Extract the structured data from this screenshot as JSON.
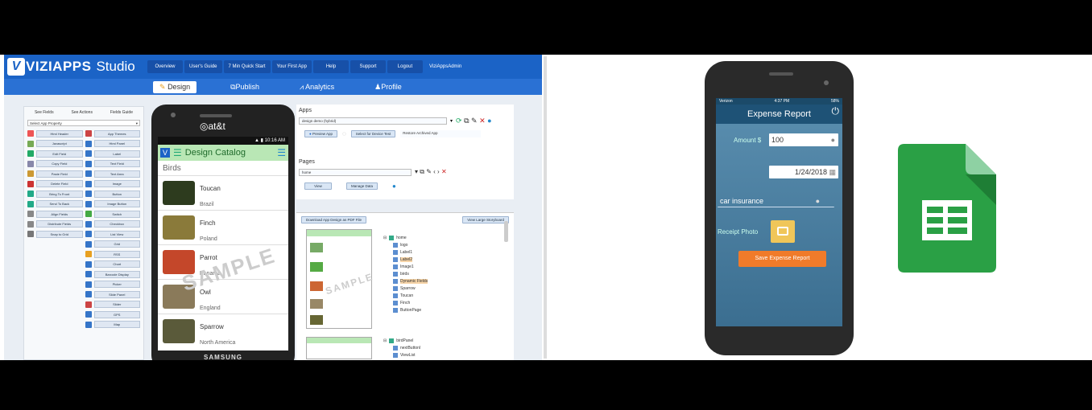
{
  "studio": {
    "logo_brand": "VIZIAPPS",
    "logo_studio": "Studio",
    "topnav": [
      "Overview",
      "User's Guide",
      "7 Min Quick Start",
      "Your First App",
      "Help",
      "Support",
      "Logout",
      "ViziAppsAdmin"
    ],
    "tabs": [
      "Design",
      "Publish",
      "Analytics",
      "Profile"
    ],
    "left_panel": {
      "tabs": [
        "See Fields",
        "See Actions",
        "Fields Guide"
      ],
      "property_select": "Select App Property",
      "col1": [
        "Html Header",
        "Javascript",
        "Edit Field",
        "Copy Field",
        "Paste Field",
        "Delete Field",
        "Bring To Front",
        "Send To Back",
        "Align Fields",
        "Distribute Fields",
        "Snap to Grid"
      ],
      "col2": [
        "App Themes",
        "Html Panel",
        "Label",
        "Text Field",
        "Text Area",
        "Image",
        "Button",
        "Image Button",
        "Switch",
        "Checkbox",
        "List View",
        "Grid",
        "RSS",
        "Chart",
        "Barcode Display",
        "Picker",
        "Slide Panel",
        "Slider",
        "GPS",
        "Map"
      ]
    },
    "phone": {
      "carrier": "at&t",
      "status_time": "10:16 AM",
      "title": "Design Catalog",
      "section": "Birds",
      "birds": [
        {
          "name": "Toucan",
          "place": "Brazil"
        },
        {
          "name": "Finch",
          "place": "Poland"
        },
        {
          "name": "Parrot",
          "place": "Panama"
        },
        {
          "name": "Owl",
          "place": "England"
        },
        {
          "name": "Sparrow",
          "place": "North America"
        }
      ],
      "watermark": "SAMPLE",
      "brand": "SAMSUNG"
    },
    "apps": {
      "title": "Apps",
      "app_select": "design demo (hybrid)",
      "preview_btn": "Preview App",
      "device_btn": "Select for Device Test",
      "archive_select": "Restore Archived App"
    },
    "pages": {
      "title": "Pages",
      "page_select": "home",
      "view_btn": "View",
      "manage_btn": "Manage Data"
    },
    "tree": {
      "download_btn": "Download App Design as PDF File",
      "large_view_btn": "View Large Storyboard",
      "root1": "home",
      "items1": [
        "logo",
        "Label1",
        "Label2",
        "Image1",
        "birds",
        "Dynamic Fields",
        "Sparrow",
        "Toucan",
        "Finch",
        "ButtonPage"
      ],
      "root2": "birdPanel",
      "items2": [
        "nextButtonl",
        "ViewList"
      ]
    }
  },
  "expense": {
    "carrier": "Verizon",
    "time": "4:37 PM",
    "battery": "58%",
    "title": "Expense Report",
    "amount_label": "Amount $",
    "amount_value": "100",
    "date_value": "1/24/2018",
    "desc_value": "car insurance",
    "photo_label": "Receipt Photo",
    "save_btn": "Save Expense Report"
  },
  "colors": {
    "studio_blue": "#1b63c6",
    "expense_header": "#1e5276",
    "save_orange": "#f07b2a",
    "sheets_green": "#2aa045"
  }
}
